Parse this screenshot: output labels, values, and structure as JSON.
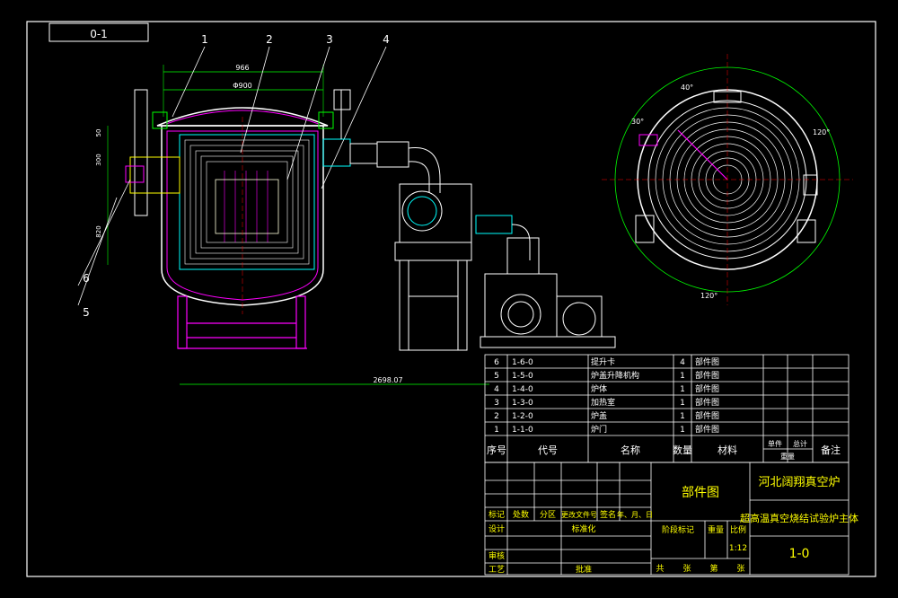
{
  "drawing": {
    "code_box": "0-1",
    "callouts": [
      "1",
      "2",
      "3",
      "4",
      "5",
      "6"
    ],
    "dimensions": {
      "top_outer": "966",
      "top_inner": "Φ900",
      "left_1": "50",
      "left_2": "300",
      "left_3": "820",
      "bottom": "2698.07"
    },
    "angles": {
      "a40": "40°",
      "a30": "30°",
      "a120_right": "120°",
      "a120_bottom": "120°"
    }
  },
  "parts_list": {
    "rows": [
      {
        "no": "6",
        "code": "1-6-0",
        "name": "提升卡",
        "qty": "4",
        "material": "部件图"
      },
      {
        "no": "5",
        "code": "1-5-0",
        "name": "炉盖升降机构",
        "qty": "1",
        "material": "部件图"
      },
      {
        "no": "4",
        "code": "1-4-0",
        "name": "炉体",
        "qty": "1",
        "material": "部件图"
      },
      {
        "no": "3",
        "code": "1-3-0",
        "name": "加热室",
        "qty": "1",
        "material": "部件图"
      },
      {
        "no": "2",
        "code": "1-2-0",
        "name": "炉盖",
        "qty": "1",
        "material": "部件图"
      },
      {
        "no": "1",
        "code": "1-1-0",
        "name": "炉门",
        "qty": "1",
        "material": "部件图"
      }
    ],
    "headers": {
      "no": "序号",
      "code": "代号",
      "name": "名称",
      "qty": "数量",
      "material": "材料",
      "unit_weight": "单件",
      "total_weight": "总计",
      "weight": "重量",
      "remark": "备注"
    }
  },
  "title_block": {
    "company": "河北阔翔真空炉",
    "center_title": "部件图",
    "drawing_name": "超高温真空烧结试验炉主体",
    "drawing_no": "1-0",
    "scale_label": "比例",
    "weight_label": "重量",
    "stage_label": "阶段标记",
    "scale": "1:12",
    "sheets_total": "共",
    "sheets_label": "张",
    "sheet_no": "第",
    "sheet_label": "张",
    "rev_cols": [
      "标记",
      "处数",
      "分区",
      "更改文件号",
      "签名",
      "年、月、日"
    ],
    "design": "设计",
    "standardize": "标准化",
    "review": "审核",
    "process": "工艺",
    "approve": "批准"
  }
}
